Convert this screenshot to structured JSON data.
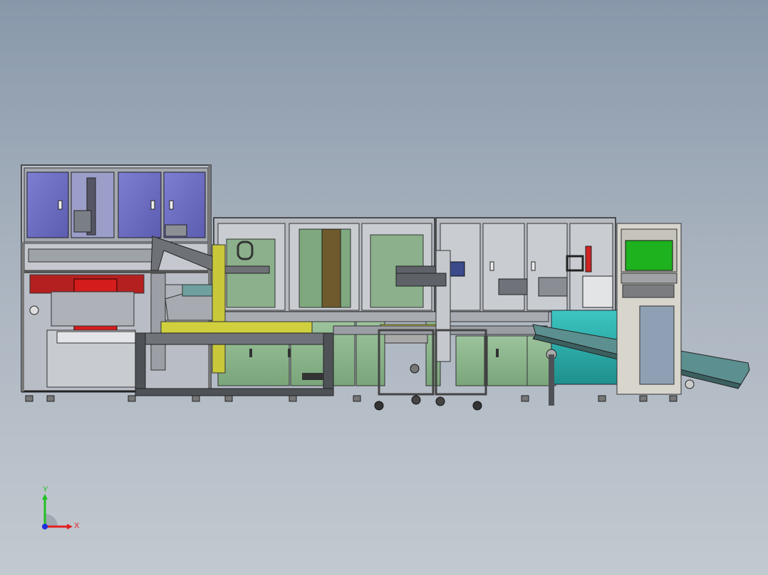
{
  "viewport": {
    "background_top": "#8898aa",
    "background_bottom": "#c3c9d0"
  },
  "model": {
    "frame_color": "#9aa0a6",
    "panel_blue": "#6f6fc4",
    "panel_grey": "#b8bcc4",
    "cabinet_green": "#8fb58f",
    "accent_yellow": "#c8c83a",
    "accent_red": "#d01c1c",
    "conveyor_teal": "#2fb4b0",
    "screen_green": "#1fb21f"
  },
  "triad": {
    "x_label": "X",
    "y_label": "Y",
    "x_color": "#e02020",
    "y_color": "#20c020",
    "z_color": "#2030e0",
    "icon": "coordinate-triad-icon"
  }
}
